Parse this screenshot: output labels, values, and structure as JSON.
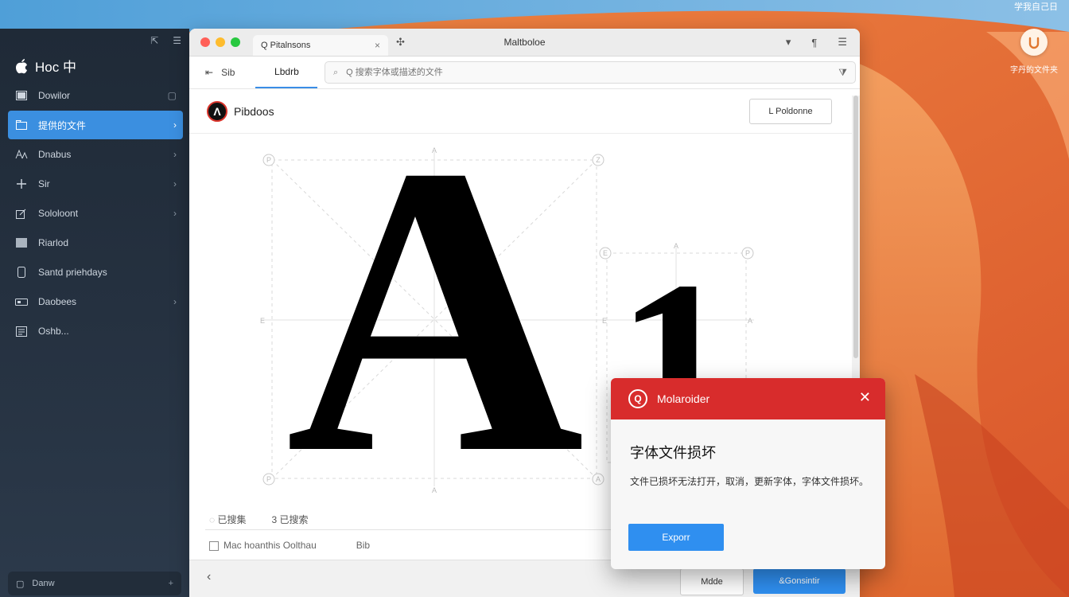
{
  "desktop": {
    "top_right_text": "学我自己日",
    "icon_label": "字丹的文件夹"
  },
  "sidebar": {
    "brand": "Hoc 中",
    "items": [
      {
        "label": "Dowilor",
        "icon": "window-icon",
        "chevron": false,
        "trailing": "square"
      },
      {
        "label": "提供的文件",
        "icon": "folder-icon",
        "chevron": true,
        "active": true
      },
      {
        "label": "Dnabus",
        "icon": "fonts-icon",
        "chevron": true
      },
      {
        "label": "Sir",
        "icon": "plus-icon",
        "chevron": true
      },
      {
        "label": "Sololoont",
        "icon": "edit-icon",
        "chevron": true
      },
      {
        "label": "Riarlod",
        "icon": "grid-icon",
        "chevron": false
      },
      {
        "label": "Santd priehdays",
        "icon": "phone-icon",
        "chevron": false
      },
      {
        "label": "Daobees",
        "icon": "drive-icon",
        "chevron": true
      },
      {
        "label": "Oshb...",
        "icon": "list-icon",
        "chevron": false
      }
    ],
    "bottom_label": "Danw"
  },
  "window": {
    "tab_label": "Q Pitalnsons",
    "title": "Maltboloe",
    "toolbar_back_label": "Sib",
    "toolbar_tab_label": "Lbdrb",
    "search_placeholder": "Q 搜索字体或描述的文件",
    "app_name": "Pibdoos",
    "header_button": "L Poldonne",
    "glyph_a": "A",
    "glyph_1": "1",
    "status_left": "已搜集",
    "status_right": "3 已搜索",
    "checkbox_label": "Mac hoanthis Oolthau",
    "checkbox_value": "Bib",
    "bottom_btn1": "Mdde",
    "bottom_btn2": "&Gonsintir"
  },
  "dialog": {
    "title": "Molaroider",
    "heading": "字体文件损坏",
    "body": "文件已损坏无法打开，取消，更新字体，字体文件损坏。",
    "button": "Exporr",
    "header_color": "#d82c2c"
  },
  "colors": {
    "accent": "#3b8fe0",
    "primary_button": "#2f8ff0",
    "error": "#d82c2c"
  }
}
